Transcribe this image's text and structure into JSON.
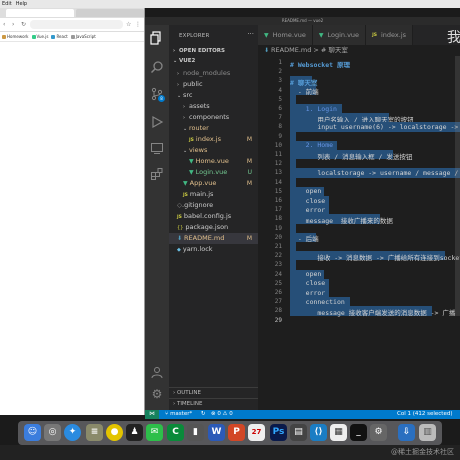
{
  "menubar": {
    "items": [
      "Edit",
      "Help"
    ]
  },
  "browser": {
    "bookmarks": [
      "Homework",
      "Vue.js",
      "React",
      "JavaScript"
    ]
  },
  "vscode": {
    "window_title": "README.md — vue2",
    "explorer": {
      "header": "EXPLORER",
      "open_editors": "OPEN EDITORS",
      "project": "VUE2",
      "outline": "OUTLINE",
      "timeline": "TIMELINE",
      "tree": [
        {
          "label": "node_modules",
          "indent": 1,
          "kind": "folder-closed",
          "style": "dim",
          "badge": ""
        },
        {
          "label": "public",
          "indent": 1,
          "kind": "folder-closed",
          "style": "",
          "badge": ""
        },
        {
          "label": "src",
          "indent": 1,
          "kind": "folder-open",
          "style": "",
          "badge": ""
        },
        {
          "label": "assets",
          "indent": 2,
          "kind": "folder-closed",
          "style": "",
          "badge": ""
        },
        {
          "label": "components",
          "indent": 2,
          "kind": "folder-closed",
          "style": "",
          "badge": ""
        },
        {
          "label": "router",
          "indent": 2,
          "kind": "folder-open",
          "style": "modified",
          "badge": ""
        },
        {
          "label": "index.js",
          "indent": 3,
          "kind": "js",
          "style": "modified",
          "badge": "M"
        },
        {
          "label": "views",
          "indent": 2,
          "kind": "folder-open",
          "style": "modified",
          "badge": ""
        },
        {
          "label": "Home.vue",
          "indent": 3,
          "kind": "vue",
          "style": "modified",
          "badge": "M"
        },
        {
          "label": "Login.vue",
          "indent": 3,
          "kind": "vue",
          "style": "untracked",
          "badge": "U"
        },
        {
          "label": "App.vue",
          "indent": 2,
          "kind": "vue",
          "style": "modified",
          "badge": "M"
        },
        {
          "label": "main.js",
          "indent": 2,
          "kind": "js",
          "style": "",
          "badge": ""
        },
        {
          "label": ".gitignore",
          "indent": 1,
          "kind": "git",
          "style": "",
          "badge": ""
        },
        {
          "label": "babel.config.js",
          "indent": 1,
          "kind": "js",
          "style": "",
          "badge": ""
        },
        {
          "label": "package.json",
          "indent": 1,
          "kind": "json",
          "style": "",
          "badge": ""
        },
        {
          "label": "README.md",
          "indent": 1,
          "kind": "md",
          "style": "modified",
          "badge": "M",
          "selected": true
        },
        {
          "label": "yarn.lock",
          "indent": 1,
          "kind": "lock",
          "style": "",
          "badge": ""
        }
      ]
    },
    "tabs": [
      {
        "label": "Home.vue",
        "kind": "vue",
        "active": false
      },
      {
        "label": "Login.vue",
        "kind": "vue",
        "active": false
      },
      {
        "label": "index.js",
        "kind": "js",
        "active": false
      }
    ],
    "tab_overflow": "我",
    "breadcrumb": "README.md > # 聊天室",
    "editor": {
      "lines": [
        {
          "n": "1",
          "text": "# Websocket 原理",
          "cls": "md-head",
          "sel": false
        },
        {
          "n": "2",
          "text": "",
          "cls": "",
          "sel": false
        },
        {
          "n": "3",
          "text": "# 聊天室",
          "cls": "md-head",
          "sel": true
        },
        {
          "n": "4",
          "text": "  - 前端",
          "cls": "",
          "sel": true
        },
        {
          "n": "5",
          "text": "",
          "cls": "",
          "sel": true
        },
        {
          "n": "6",
          "text": "    1. Login",
          "cls": "md-num",
          "sel": true
        },
        {
          "n": "7",
          "text": "       用户名输入 / 进入聊天室的按钮",
          "cls": "",
          "sel": true
        },
        {
          "n": "8",
          "text": "       input username(6) -> localstorage -> e",
          "cls": "",
          "sel": true
        },
        {
          "n": "9",
          "text": "",
          "cls": "",
          "sel": true
        },
        {
          "n": "10",
          "text": "    2. Home",
          "cls": "md-num",
          "sel": true
        },
        {
          "n": "11",
          "text": "       列表 / 消息输入框 / 发送按钮",
          "cls": "",
          "sel": true
        },
        {
          "n": "12",
          "text": "",
          "cls": "",
          "sel": true
        },
        {
          "n": "13",
          "text": "       localstorage -> username / message / i",
          "cls": "",
          "sel": true
        },
        {
          "n": "14",
          "text": "",
          "cls": "",
          "sel": true
        },
        {
          "n": "15",
          "text": "    open",
          "cls": "",
          "sel": true
        },
        {
          "n": "16",
          "text": "    close",
          "cls": "",
          "sel": true
        },
        {
          "n": "17",
          "text": "    error",
          "cls": "",
          "sel": true
        },
        {
          "n": "18",
          "text": "    message  接收广播来的数据",
          "cls": "",
          "sel": true
        },
        {
          "n": "19",
          "text": "",
          "cls": "",
          "sel": true
        },
        {
          "n": "20",
          "text": "  - 后端",
          "cls": "",
          "sel": true
        },
        {
          "n": "21",
          "text": "",
          "cls": "",
          "sel": true
        },
        {
          "n": "22",
          "text": "       接收 -> 消息数据 -> 广播给所有连接到socket的",
          "cls": "",
          "sel": true
        },
        {
          "n": "23",
          "text": "",
          "cls": "",
          "sel": true
        },
        {
          "n": "24",
          "text": "    open",
          "cls": "",
          "sel": true
        },
        {
          "n": "25",
          "text": "    close",
          "cls": "",
          "sel": true
        },
        {
          "n": "26",
          "text": "    error",
          "cls": "",
          "sel": true
        },
        {
          "n": "27",
          "text": "    connection",
          "cls": "",
          "sel": true
        },
        {
          "n": "28",
          "text": "       message 接收客户端发送的消息数据 -> 广播",
          "cls": "",
          "sel": true
        },
        {
          "n": "29",
          "text": "",
          "cls": "",
          "sel": false
        }
      ]
    },
    "status": {
      "branch": "master*",
      "errors": "0",
      "warnings": "0",
      "cursor": "Col 1 (412 selected)"
    }
  },
  "watermark": "@稀土掘金技术社区",
  "colors": {
    "statusbar": "#007acc",
    "selection": "#264f78",
    "activity": "#333333"
  }
}
